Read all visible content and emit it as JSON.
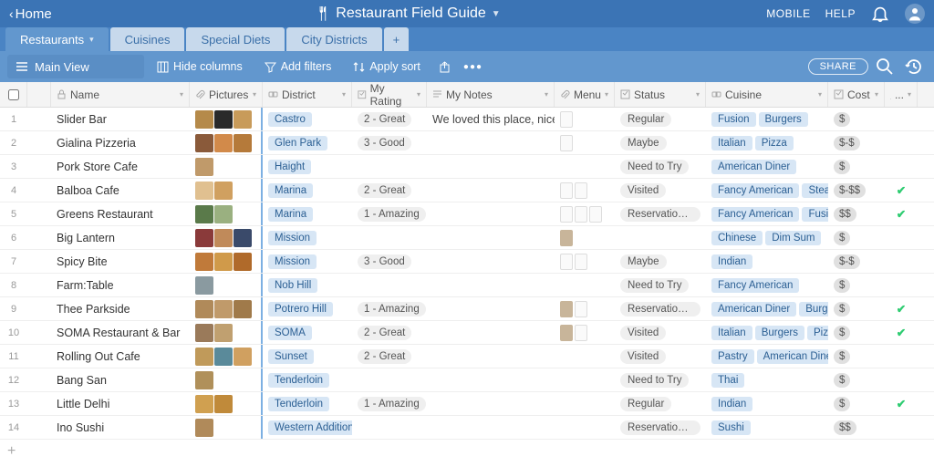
{
  "header": {
    "home": "Home",
    "title": "Restaurant Field Guide",
    "mobile": "MOBILE",
    "help": "HELP"
  },
  "tabs": [
    {
      "label": "Restaurants",
      "active": true
    },
    {
      "label": "Cuisines"
    },
    {
      "label": "Special Diets"
    },
    {
      "label": "City Districts"
    }
  ],
  "toolbar": {
    "view": "Main View",
    "hide_cols": "Hide columns",
    "add_filters": "Add filters",
    "apply_sort": "Apply sort",
    "share": "SHARE"
  },
  "columns": {
    "name": "Name",
    "pictures": "Pictures",
    "district": "District",
    "rating": "My Rating",
    "notes": "My Notes",
    "menu": "Menu",
    "status": "Status",
    "cuisine": "Cuisine",
    "cost": "Cost",
    "check": "..."
  },
  "rows": [
    {
      "n": "1",
      "name": "Slider Bar",
      "pics": 3,
      "pc": [
        "#b58a4a",
        "#2a2a2a",
        "#c89b5a"
      ],
      "district": "Castro",
      "rating": "2 - Great",
      "notes": "We loved this place, nice …",
      "menu": [
        {
          "img": false
        }
      ],
      "status": "Regular",
      "cuisine": [
        "Fusion",
        "Burgers"
      ],
      "cost": "$",
      "check": false
    },
    {
      "n": "2",
      "name": "Gialina Pizzeria",
      "pics": 3,
      "pc": [
        "#8a5a3a",
        "#d28a4a",
        "#b57a3a"
      ],
      "district": "Glen Park",
      "rating": "3 - Good",
      "notes": "",
      "menu": [
        {
          "img": false
        }
      ],
      "status": "Maybe",
      "cuisine": [
        "Italian",
        "Pizza"
      ],
      "cost": "$-$",
      "check": false
    },
    {
      "n": "3",
      "name": "Pork Store Cafe",
      "pics": 1,
      "pc": [
        "#c09a6a"
      ],
      "district": "Haight",
      "rating": "",
      "notes": "",
      "menu": [],
      "status": "Need to Try",
      "cuisine": [
        "American Diner"
      ],
      "cost": "$",
      "check": false
    },
    {
      "n": "4",
      "name": "Balboa Cafe",
      "pics": 2,
      "pc": [
        "#e0c090",
        "#d0a060"
      ],
      "district": "Marina",
      "rating": "2 - Great",
      "notes": "",
      "menu": [
        {
          "img": false
        },
        {
          "img": false
        }
      ],
      "status": "Visited",
      "cuisine": [
        "Fancy American",
        "Steak"
      ],
      "cost": "$-$$",
      "check": true
    },
    {
      "n": "5",
      "name": "Greens Restaurant",
      "pics": 2,
      "pc": [
        "#5a7a4a",
        "#9ab080"
      ],
      "district": "Marina",
      "rating": "1 - Amazing",
      "notes": "",
      "menu": [
        {
          "img": false
        },
        {
          "img": false
        },
        {
          "img": false
        }
      ],
      "status": "Reservation …",
      "cuisine": [
        "Fancy American",
        "Fusion"
      ],
      "cost": "$$",
      "check": true
    },
    {
      "n": "6",
      "name": "Big Lantern",
      "pics": 3,
      "pc": [
        "#8a3a3a",
        "#c08a5a",
        "#3a4a6a"
      ],
      "district": "Mission",
      "rating": "",
      "notes": "",
      "menu": [
        {
          "img": true
        }
      ],
      "status": "",
      "cuisine": [
        "Chinese",
        "Dim Sum"
      ],
      "cost": "$",
      "check": false
    },
    {
      "n": "7",
      "name": "Spicy Bite",
      "pics": 3,
      "pc": [
        "#c07a3a",
        "#d09a4a",
        "#b06a2a"
      ],
      "district": "Mission",
      "rating": "3 - Good",
      "notes": "",
      "menu": [
        {
          "img": false
        },
        {
          "img": false
        }
      ],
      "status": "Maybe",
      "cuisine": [
        "Indian"
      ],
      "cost": "$-$",
      "check": false
    },
    {
      "n": "8",
      "name": "Farm:Table",
      "pics": 1,
      "pc": [
        "#8a9aa0"
      ],
      "district": "Nob Hill",
      "rating": "",
      "notes": "",
      "menu": [],
      "status": "Need to Try",
      "cuisine": [
        "Fancy American"
      ],
      "cost": "$",
      "check": false
    },
    {
      "n": "9",
      "name": "Thee Parkside",
      "pics": 3,
      "pc": [
        "#b08a5a",
        "#c09a6a",
        "#a07a4a"
      ],
      "district": "Potrero Hill",
      "rating": "1 - Amazing",
      "notes": "",
      "menu": [
        {
          "img": true
        },
        {
          "img": false
        }
      ],
      "status": "Reservation …",
      "cuisine": [
        "American Diner",
        "Burgers"
      ],
      "cost": "$",
      "check": true
    },
    {
      "n": "10",
      "name": "SOMA Restaurant & Bar",
      "pics": 2,
      "pc": [
        "#9a7a5a",
        "#c0a070"
      ],
      "district": "SOMA",
      "rating": "2 - Great",
      "notes": "",
      "menu": [
        {
          "img": true
        },
        {
          "img": false
        }
      ],
      "status": "Visited",
      "cuisine": [
        "Italian",
        "Burgers",
        "Pizza"
      ],
      "cost": "$",
      "check": true
    },
    {
      "n": "11",
      "name": "Rolling Out Cafe",
      "pics": 3,
      "pc": [
        "#c09a5a",
        "#5a8a9a",
        "#d0a060"
      ],
      "district": "Sunset",
      "rating": "2 - Great",
      "notes": "",
      "menu": [],
      "status": "Visited",
      "cuisine": [
        "Pastry",
        "American Diner"
      ],
      "cost": "$",
      "check": false
    },
    {
      "n": "12",
      "name": "Bang San",
      "pics": 1,
      "pc": [
        "#b0905a"
      ],
      "district": "Tenderloin",
      "rating": "",
      "notes": "",
      "menu": [],
      "status": "Need to Try",
      "cuisine": [
        "Thai"
      ],
      "cost": "$",
      "check": false
    },
    {
      "n": "13",
      "name": "Little Delhi",
      "pics": 2,
      "pc": [
        "#d0a050",
        "#c08a3a"
      ],
      "district": "Tenderloin",
      "rating": "1 - Amazing",
      "notes": "",
      "menu": [],
      "status": "Regular",
      "cuisine": [
        "Indian"
      ],
      "cost": "$",
      "check": true
    },
    {
      "n": "14",
      "name": "Ino Sushi",
      "pics": 1,
      "pc": [
        "#b08a5a"
      ],
      "district": "Western Addition",
      "rating": "",
      "notes": "",
      "menu": [],
      "status": "Reservation …",
      "cuisine": [
        "Sushi"
      ],
      "cost": "$$",
      "check": false
    }
  ]
}
